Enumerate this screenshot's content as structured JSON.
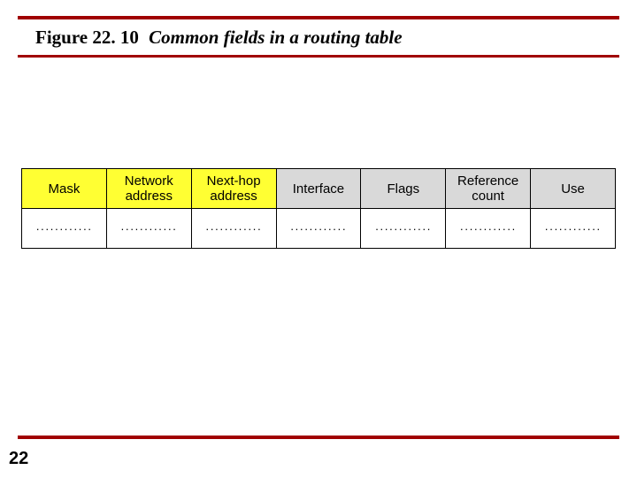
{
  "figure": {
    "number": "Figure 22. 10",
    "caption": "Common fields in a routing table"
  },
  "table": {
    "headers": [
      {
        "label": "Mask",
        "style": "yellow"
      },
      {
        "label": "Network address",
        "style": "yellow"
      },
      {
        "label": "Next-hop address",
        "style": "yellow"
      },
      {
        "label": "Interface",
        "style": "grey"
      },
      {
        "label": "Flags",
        "style": "grey"
      },
      {
        "label": "Reference count",
        "style": "grey"
      },
      {
        "label": "Use",
        "style": "grey"
      }
    ],
    "row_placeholder": "············"
  },
  "page_number": "22"
}
